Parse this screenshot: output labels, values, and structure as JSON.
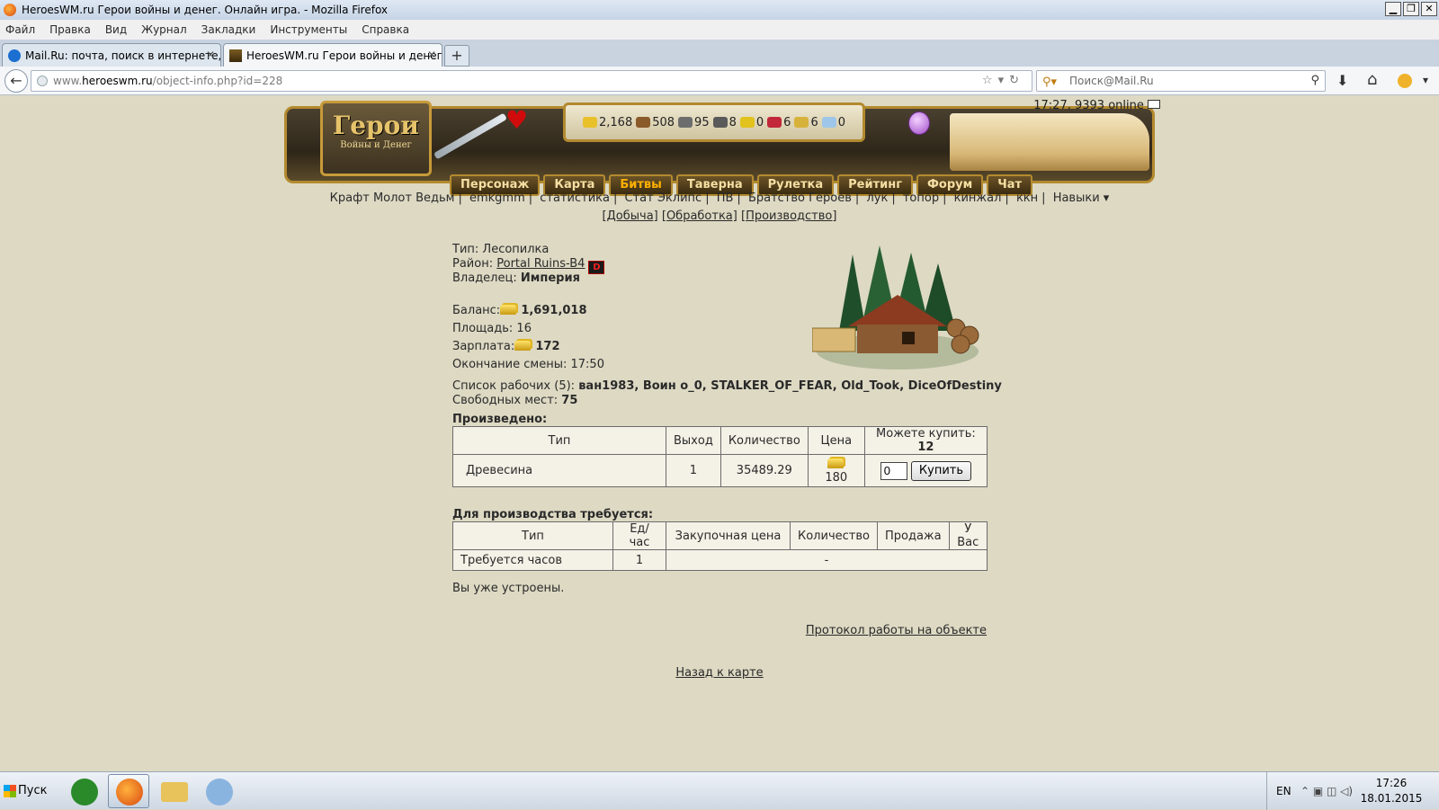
{
  "window": {
    "title": "HeroesWM.ru Герои войны и денег. Онлайн игра. - Mozilla Firefox",
    "controls": {
      "minimize": "▁",
      "restore": "❐",
      "close": "✕"
    }
  },
  "menu": [
    "Файл",
    "Правка",
    "Вид",
    "Журнал",
    "Закладки",
    "Инструменты",
    "Справка"
  ],
  "tabs": [
    {
      "label": "Mail.Ru: почта, поиск в интернете, н...",
      "icon": "mailru-icon",
      "active": false
    },
    {
      "label": "HeroesWM.ru Герои войны и денег. ...",
      "icon": "heroeswm-icon",
      "active": true
    }
  ],
  "newtab_label": "+",
  "nav": {
    "url_prefix": "www.",
    "url_domain": "heroeswm.ru",
    "url_path": "/object-info.php?id=228",
    "url_icons": "☆▾↻",
    "search_placeholder": "Поиск@Mail.Ru",
    "back": "←",
    "download": "⬇",
    "home": "⌂",
    "menu": "▾"
  },
  "header": {
    "logo_title": "Герои",
    "logo_subtitle": "Войны и Денег",
    "resources": [
      {
        "value": "2,168",
        "icon": "gold-icon",
        "color": "#e8c02a"
      },
      {
        "value": "508",
        "icon": "wood-icon",
        "color": "#8a5a2a"
      },
      {
        "value": "95",
        "icon": "ore-icon",
        "color": "#6d6d6d"
      },
      {
        "value": "8",
        "icon": "mercury-icon",
        "color": "#5a5a5a"
      },
      {
        "value": "0",
        "icon": "sulfur-icon",
        "color": "#e2c21c"
      },
      {
        "value": "6",
        "icon": "crystal-icon",
        "color": "#c2283a"
      },
      {
        "value": "6",
        "icon": "gems-icon",
        "color": "#d7b23a"
      },
      {
        "value": "0",
        "icon": "diamond-icon",
        "color": "#9ec6e8"
      }
    ],
    "nav": [
      "Персонаж",
      "Карта",
      "Битвы",
      "Таверна",
      "Рулетка",
      "Рейтинг",
      "Форум",
      "Чат"
    ],
    "nav_highlight": "Битвы",
    "server_time": "17:27, 9393 online"
  },
  "quick_links": [
    "Крафт Молот Ведьм",
    "emkgmm",
    "статистика",
    "Стат Эклипс",
    "ПВ",
    "Братство Героев",
    "лук",
    "топор",
    "кинжал",
    "ккн",
    "Навыки ▾"
  ],
  "subnav": [
    "[Добыча]",
    "[Обработка]",
    "[Производство]"
  ],
  "object": {
    "type_label": "Тип:",
    "type": "Лесопилка",
    "district_label": "Район:",
    "district": "Portal Ruins-B4",
    "district_badge": "D",
    "owner_label": "Владелец:",
    "owner": "Империя",
    "balance_label": "Баланс:",
    "balance": "1,691,018",
    "area_label": "Площадь:",
    "area": "16",
    "salary_label": "Зарплата:",
    "salary": "172",
    "shift_end_label": "Окончание смены:",
    "shift_end": "17:50",
    "workers_label": "Список рабочих (5):",
    "workers": "ван1983, Воин о_0, STALKER_OF_FEAR, Old_Took, DiceOfDestiny",
    "free_label": "Свободных мест:",
    "free": "75"
  },
  "produced": {
    "heading": "Произведено:",
    "headers": [
      "Тип",
      "Выход",
      "Количество",
      "Цена",
      "Можете купить:"
    ],
    "can_buy": "12",
    "row": {
      "type": "Древесина",
      "output": "1",
      "quantity": "35489.29",
      "price": "180",
      "input_value": "0",
      "buy_label": "Купить"
    }
  },
  "required": {
    "heading": "Для производства требуется:",
    "headers": [
      "Тип",
      "Ед/час",
      "Закупочная цена",
      "Количество",
      "Продажа",
      "У Вас"
    ],
    "row": {
      "type": "Требуется часов",
      "per_hour": "1",
      "rest": "-"
    }
  },
  "status_text": "Вы уже устроены.",
  "protocol_link": "Протокол работы на объекте",
  "back_link": "Назад к карте",
  "taskbar": {
    "start": "Пуск",
    "apps": [
      {
        "icon": "utorrent-icon",
        "color": "#2a8a2a"
      },
      {
        "icon": "firefox-icon",
        "color": "#e0631a"
      },
      {
        "icon": "explorer-icon",
        "color": "#e8c25a"
      },
      {
        "icon": "paint-icon",
        "color": "#8ab4e0"
      }
    ],
    "lang": "EN",
    "clock_time": "17:26",
    "clock_date": "18.01.2015"
  }
}
